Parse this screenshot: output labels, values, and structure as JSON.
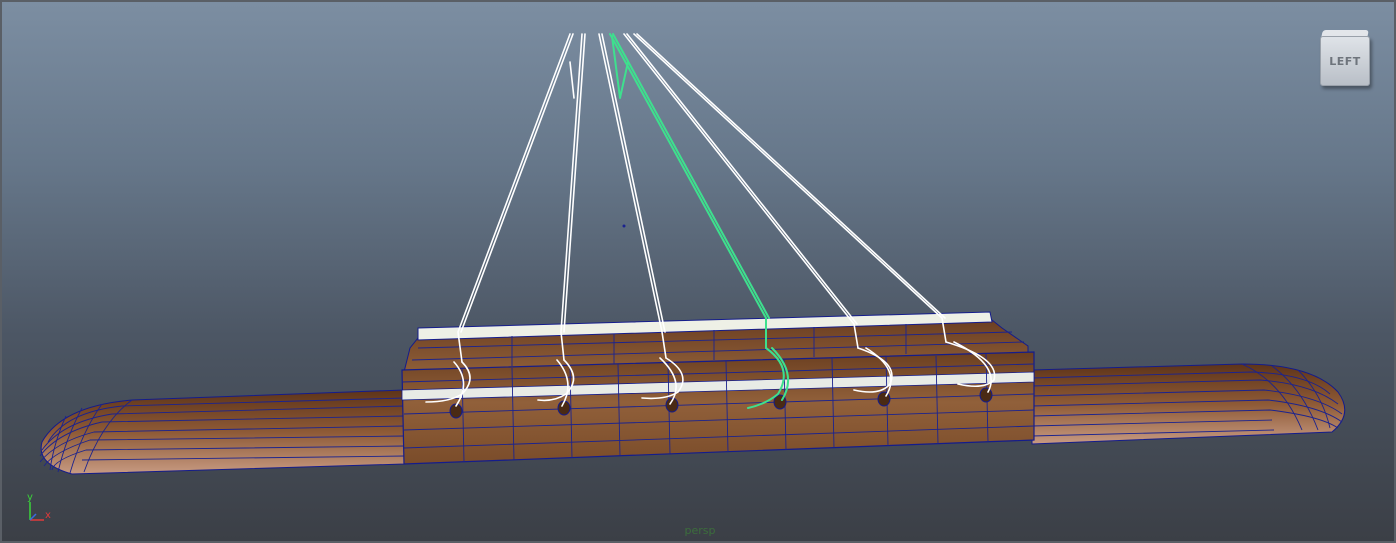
{
  "viewport": {
    "camera_name": "persp",
    "viewcube_label": "LEFT"
  },
  "axis_gizmo": {
    "y_label": "y",
    "x_label": "x",
    "colors": {
      "y": "#3ad43a",
      "x": "#e03a3a",
      "z": "#3a6ae0"
    }
  },
  "colors": {
    "background_top": "#7c8ea2",
    "background_bottom": "#3b3f46",
    "wood": "#8a5a34",
    "wireframe": "#141c8c",
    "string_default": "#ffffff",
    "string_selected": "#3ee08e",
    "saddle": "#eef0e6"
  },
  "scene": {
    "object": "guitar-bridge",
    "string_count": 6,
    "selected_string_index": 3
  }
}
